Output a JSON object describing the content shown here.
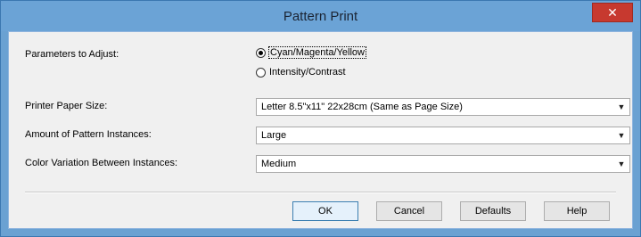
{
  "window": {
    "title": "Pattern Print",
    "close_label": "✕"
  },
  "form": {
    "params_label": "Parameters to Adjust:",
    "radio_options": [
      {
        "label": "Cyan/Magenta/Yellow",
        "checked": true
      },
      {
        "label": "Intensity/Contrast",
        "checked": false
      }
    ],
    "paper_size_label": "Printer Paper Size:",
    "paper_size_value": "Letter 8.5\"x11\" 22x28cm (Same as Page Size)",
    "amount_label": "Amount of Pattern Instances:",
    "amount_value": "Large",
    "variation_label": "Color Variation Between Instances:",
    "variation_value": "Medium"
  },
  "buttons": {
    "ok": "OK",
    "cancel": "Cancel",
    "defaults": "Defaults",
    "help": "Help"
  }
}
